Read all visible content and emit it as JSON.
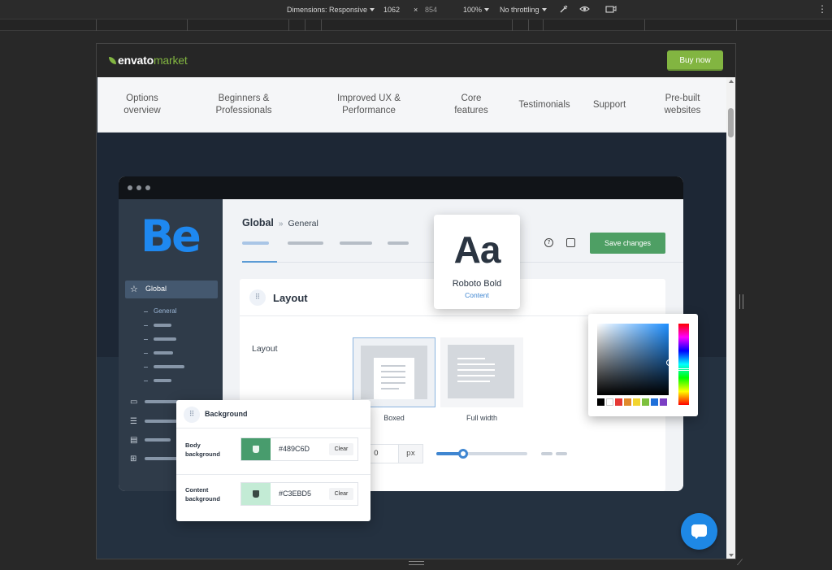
{
  "devtools": {
    "dimensions_label": "Dimensions: Responsive",
    "width": "1062",
    "times": "×",
    "height": "854",
    "zoom": "100%",
    "throttling": "No throttling",
    "more_icon": "⋮"
  },
  "site": {
    "logo_envato": "envato",
    "logo_market": "market",
    "buy_now": "Buy now",
    "nav": [
      {
        "label": "Options\noverview"
      },
      {
        "label": "Beginners &\nProfessionals"
      },
      {
        "label": "Improved UX &\nPerformance"
      },
      {
        "label": "Core\nfeatures"
      },
      {
        "label": "Testimonials"
      },
      {
        "label": "Support"
      },
      {
        "label": "Pre-built\nwebsites"
      }
    ]
  },
  "app": {
    "logo": "Be",
    "sidebar_active": "Global",
    "sidebar_sub": "General",
    "breadcrumb_main": "Global",
    "breadcrumb_sep": "»",
    "breadcrumb_sub": "General",
    "help_icon": "?",
    "save_changes": "Save changes",
    "panel_title": "Layout",
    "layout_label": "Layout",
    "options": [
      {
        "label": "Boxed",
        "selected": true
      },
      {
        "label": "Full width",
        "selected": false
      }
    ],
    "px_value": "0",
    "px_unit": "px",
    "slider_level": 0.29
  },
  "font_card": {
    "sample": "Aa",
    "font_name": "Roboto Bold",
    "context": "Content"
  },
  "color_picker": {
    "swatches": [
      "#000000",
      "#ffffff",
      "#e53935",
      "#e08a2c",
      "#f2d42e",
      "#7dc03d",
      "#1e6fd9",
      "#7b3fc4"
    ]
  },
  "background_card": {
    "title": "Background",
    "rows": [
      {
        "label": "Body\nbackground",
        "hex": "#489C6D",
        "color": "#489C6D",
        "clear": "Clear"
      },
      {
        "label": "Content\nbackground",
        "hex": "#C3EBD5",
        "color": "#C3EBD5",
        "clear": "Clear"
      }
    ]
  },
  "colors": {
    "brand_green": "#82b541",
    "accent_blue": "#1e88f0",
    "save_green": "#4e9f64"
  }
}
